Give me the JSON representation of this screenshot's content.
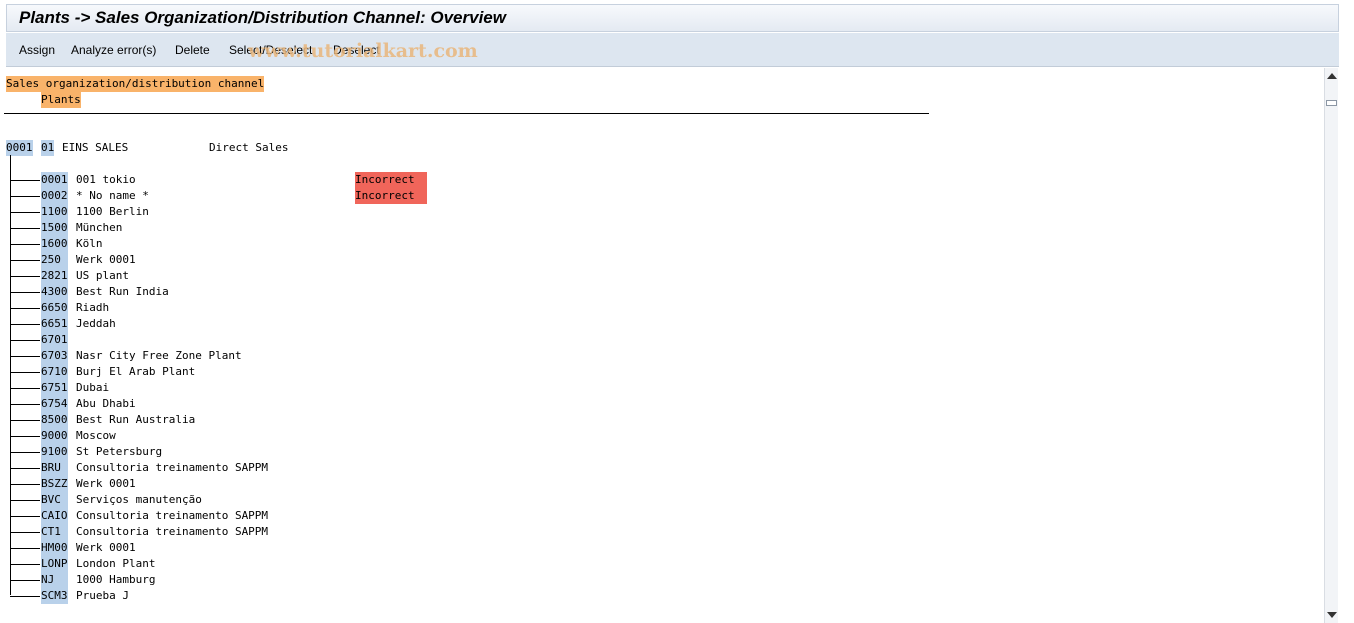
{
  "window": {
    "title": "Plants -> Sales Organization/Distribution Channel: Overview"
  },
  "toolbar": {
    "assign": "Assign",
    "analyze": "Analyze error(s)",
    "delete": "Delete",
    "select_deselect": "Select/Deselect",
    "deselect": "Deselect"
  },
  "watermark": "www.tutorialkart.com",
  "header": {
    "line1": "Sales organization/distribution channel",
    "line2": "Plants"
  },
  "root": {
    "sales_org": "0001",
    "channel": "01",
    "org_name": "EINS SALES",
    "channel_name": "Direct Sales"
  },
  "plants": [
    {
      "code": "0001",
      "name": "001 tokio",
      "status": "Incorrect"
    },
    {
      "code": "0002",
      "name": "* No name *",
      "status": "Incorrect"
    },
    {
      "code": "1100",
      "name": "1100 Berlin",
      "status": ""
    },
    {
      "code": "1500",
      "name": "München",
      "status": ""
    },
    {
      "code": "1600",
      "name": "Köln",
      "status": ""
    },
    {
      "code": "250 ",
      "name": "Werk 0001",
      "status": ""
    },
    {
      "code": "2821",
      "name": "US plant",
      "status": ""
    },
    {
      "code": "4300",
      "name": "Best Run India",
      "status": ""
    },
    {
      "code": "6650",
      "name": "Riadh",
      "status": ""
    },
    {
      "code": "6651",
      "name": "Jeddah",
      "status": ""
    },
    {
      "code": "6701",
      "name": "",
      "status": ""
    },
    {
      "code": "6703",
      "name": "Nasr City Free Zone Plant",
      "status": ""
    },
    {
      "code": "6710",
      "name": "Burj El Arab Plant",
      "status": ""
    },
    {
      "code": "6751",
      "name": "Dubai",
      "status": ""
    },
    {
      "code": "6754",
      "name": "Abu Dhabi",
      "status": ""
    },
    {
      "code": "8500",
      "name": "Best Run Australia",
      "status": ""
    },
    {
      "code": "9000",
      "name": "Moscow",
      "status": ""
    },
    {
      "code": "9100",
      "name": "St Petersburg",
      "status": ""
    },
    {
      "code": "BRU ",
      "name": "Consultoria treinamento SAPPM",
      "status": ""
    },
    {
      "code": "BSZZ",
      "name": "Werk 0001",
      "status": ""
    },
    {
      "code": "BVC ",
      "name": "Serviços manutenção",
      "status": ""
    },
    {
      "code": "CAIO",
      "name": "Consultoria treinamento SAPPM",
      "status": ""
    },
    {
      "code": "CT1 ",
      "name": "Consultoria treinamento SAPPM",
      "status": ""
    },
    {
      "code": "HM00",
      "name": "Werk 0001",
      "status": ""
    },
    {
      "code": "LONP",
      "name": "London Plant",
      "status": ""
    },
    {
      "code": "NJ  ",
      "name": "1000 Hamburg",
      "status": ""
    },
    {
      "code": "SCM3",
      "name": "Prueba J",
      "status": ""
    }
  ]
}
